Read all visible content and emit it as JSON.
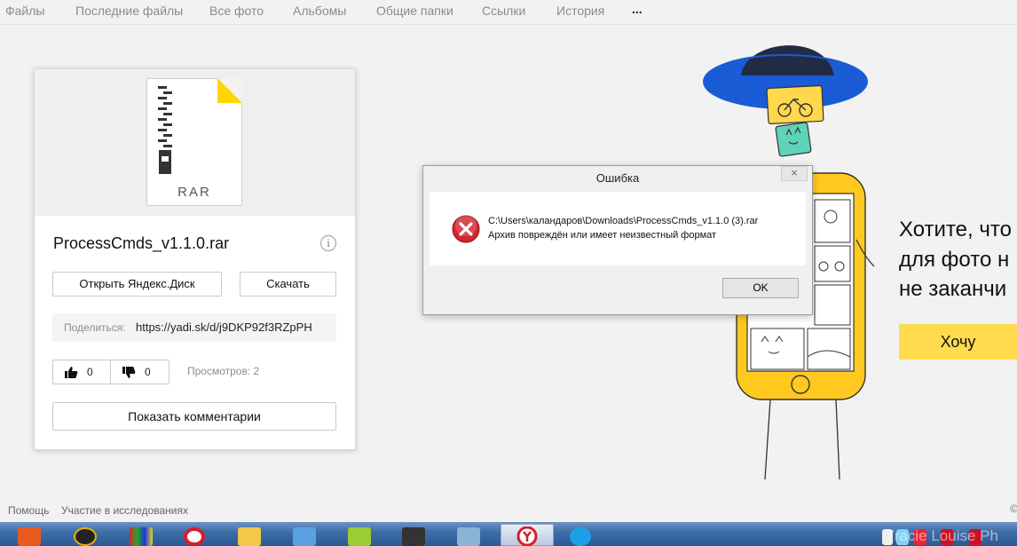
{
  "nav": {
    "items": [
      "Файлы",
      "Последние файлы",
      "Все фото",
      "Альбомы",
      "Общие папки",
      "Ссылки",
      "История"
    ],
    "more": "..."
  },
  "file": {
    "type_label": "RAR",
    "name": "ProcessCmds_v1.1.0.rar",
    "info_glyph": "i",
    "open_button": "Открыть Яндекс.Диск",
    "download_button": "Скачать",
    "share_label": "Поделиться:",
    "share_link": "https://yadi.sk/d/j9DKP92f3RZpPH",
    "likes": "0",
    "dislikes": "0",
    "views": "Просмотров: 2",
    "comments_button": "Показать комментарии"
  },
  "promo": {
    "line1": "Хотите, что",
    "line2": "для фото н",
    "line3": "не заканчи",
    "button": "Хочу"
  },
  "dialog": {
    "title": "Ошибка",
    "close": "×",
    "path": "C:\\Users\\каландаров\\Downloads\\ProcessCmds_v1.1.0 (3).rar",
    "message": "Архив повреждён или имеет неизвестный формат",
    "ok": "OK"
  },
  "footer": {
    "help": "Помощь",
    "research": "Участие в исследованиях",
    "copyright": "©"
  },
  "taskbar": {
    "tray_text": "Tracie Louise Ph"
  },
  "colors": {
    "accent_yellow": "#ffdb4d",
    "error_red": "#d22630",
    "taskbar_blue": "#3f6ea8"
  }
}
